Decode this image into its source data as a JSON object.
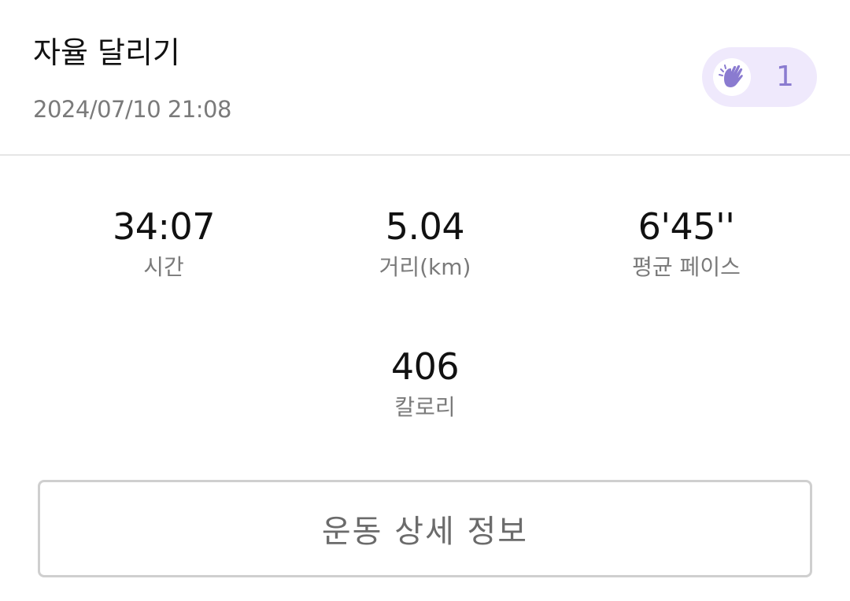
{
  "header": {
    "title": "자율 달리기",
    "datetime": "2024/07/10 21:08",
    "clap": {
      "icon": "clapping-hands-icon",
      "count": "1",
      "accent_color": "#8a7bd0",
      "background_color": "#efe9fc"
    }
  },
  "stats": {
    "time": {
      "value": "34:07",
      "label": "시간"
    },
    "distance": {
      "value": "5.04",
      "label": "거리(km)"
    },
    "pace": {
      "value": "6'45''",
      "label": "평균 페이스"
    },
    "calories": {
      "value": "406",
      "label": "칼로리"
    }
  },
  "actions": {
    "detail_label": "운동 상세 정보"
  }
}
